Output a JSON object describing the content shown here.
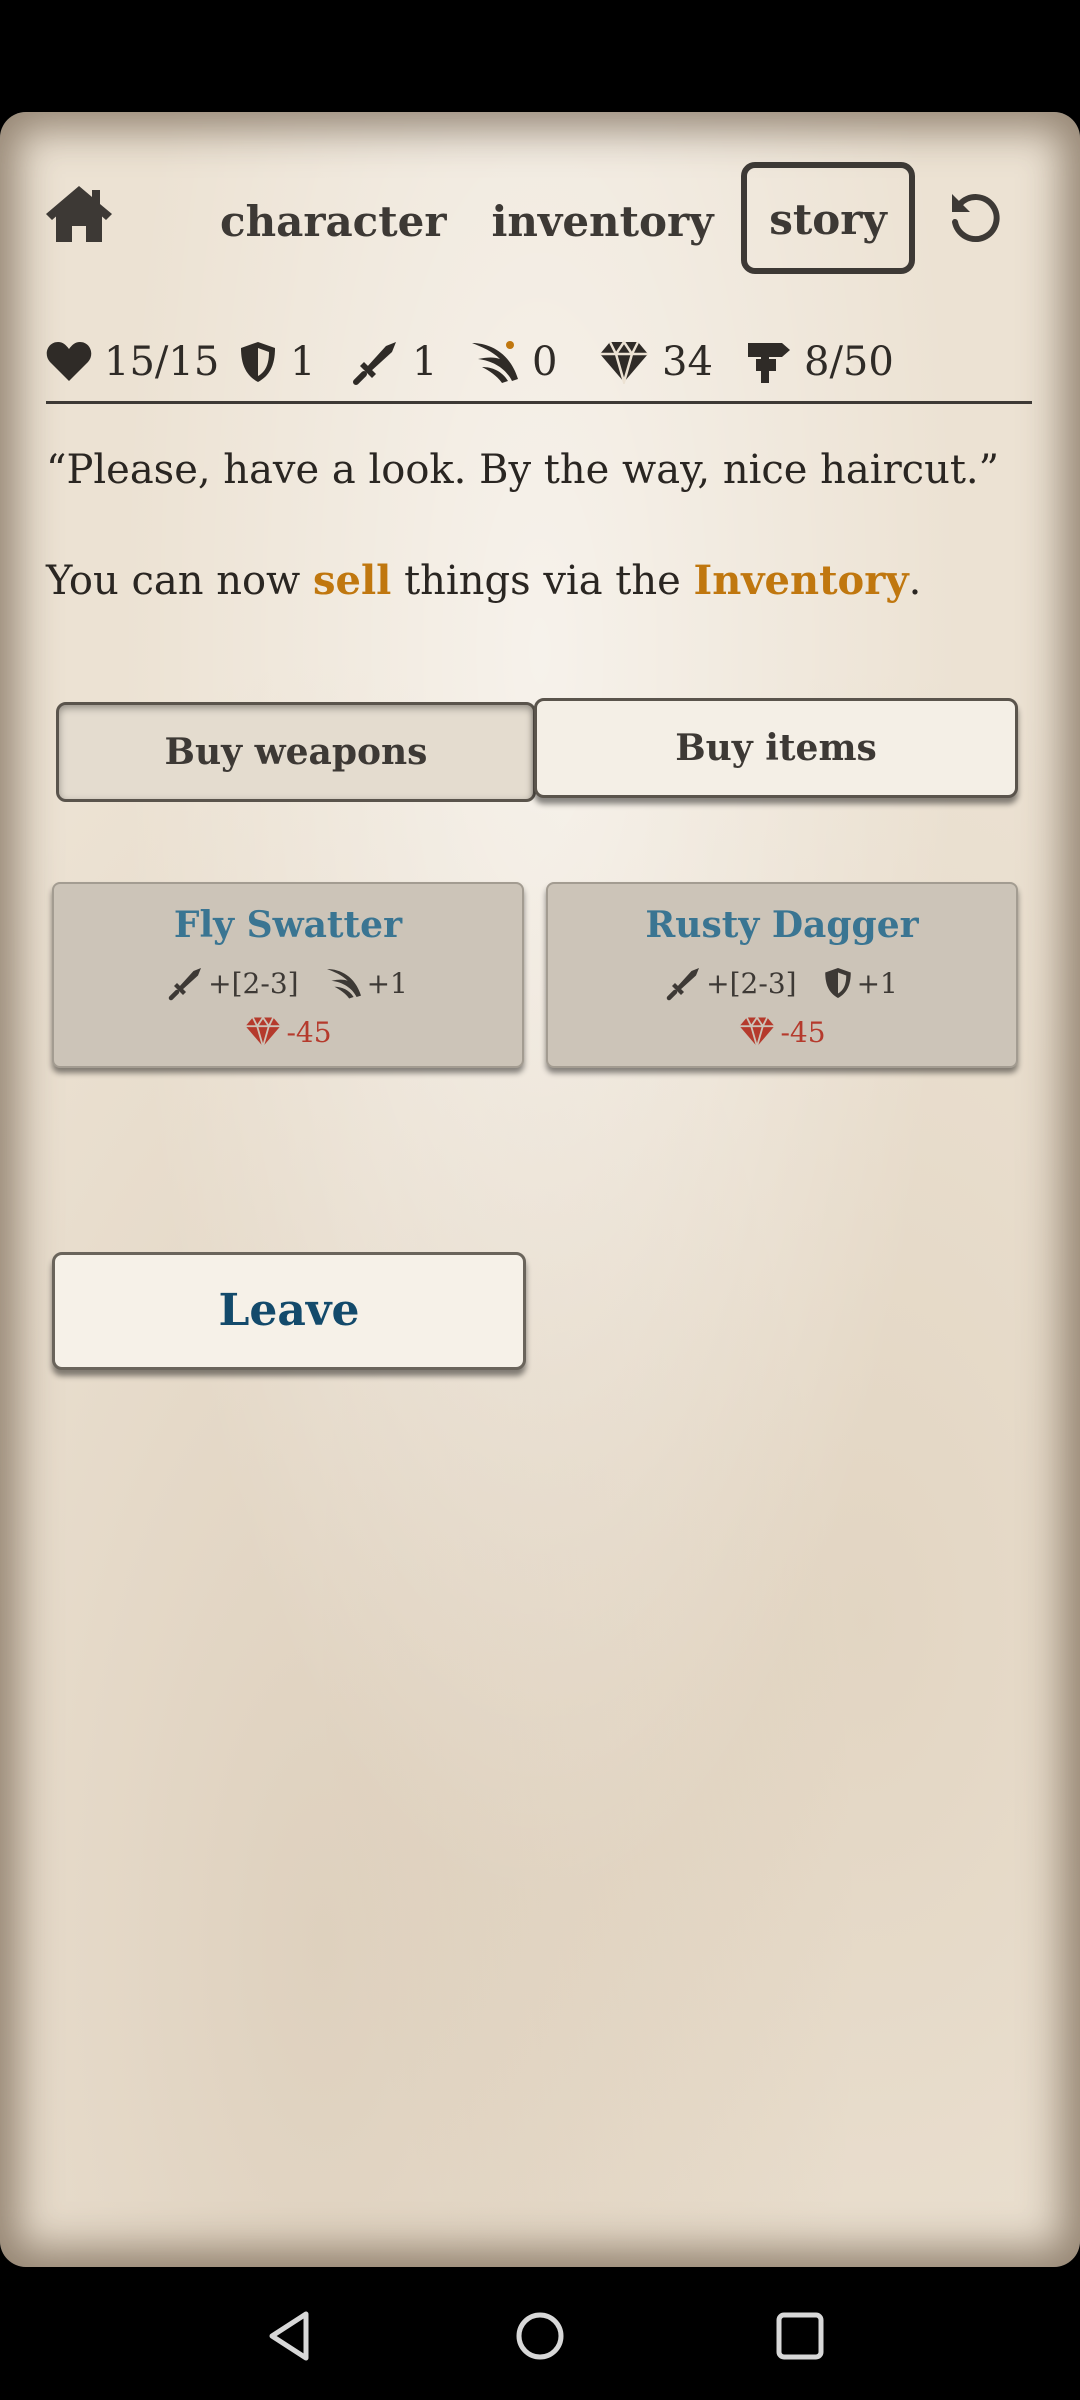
{
  "nav": {
    "home_icon": "home-icon",
    "tabs": [
      {
        "label": "character",
        "active": false
      },
      {
        "label": "inventory",
        "active": false
      },
      {
        "label": "story",
        "active": true
      }
    ],
    "undo_icon": "undo-icon"
  },
  "stats": {
    "health": {
      "icon": "heart-icon",
      "value": "15/15"
    },
    "armor": {
      "icon": "shield-icon",
      "value": "1"
    },
    "attack": {
      "icon": "sword-icon",
      "value": "1"
    },
    "agility": {
      "icon": "wing-icon",
      "value": "0"
    },
    "gems": {
      "icon": "gem-icon",
      "value": "34"
    },
    "progress": {
      "icon": "signpost-icon",
      "value": "8/50"
    }
  },
  "story": {
    "line1": "“Please, have a look. By the way, nice haircut.”",
    "line2_pre": "You can now ",
    "line2_sell": "sell",
    "line2_mid": " things via the ",
    "line2_inventory": "Inventory",
    "line2_post": "."
  },
  "shop": {
    "tabs": [
      {
        "label": "Buy weapons",
        "selected": true
      },
      {
        "label": "Buy items",
        "selected": false
      }
    ],
    "items": [
      {
        "name": "Fly Swatter",
        "stat1": {
          "icon": "sword-icon",
          "value": "+[2-3]"
        },
        "stat2": {
          "icon": "wing-icon",
          "value": "+1"
        },
        "price": "-45"
      },
      {
        "name": "Rusty Dagger",
        "stat1": {
          "icon": "sword-icon",
          "value": "+[2-3]"
        },
        "stat2": {
          "icon": "shield-icon",
          "value": "+1"
        },
        "price": "-45"
      }
    ],
    "leave_label": "Leave"
  },
  "colors": {
    "parchment": "#ece2d3",
    "highlight": "#c0770f",
    "item_title": "#3a7592",
    "price": "#b53a2c",
    "leave_text": "#134a6b"
  },
  "system_nav": {
    "back_icon": "back-icon",
    "home_icon": "circle-home-icon",
    "recents_icon": "recents-icon"
  }
}
